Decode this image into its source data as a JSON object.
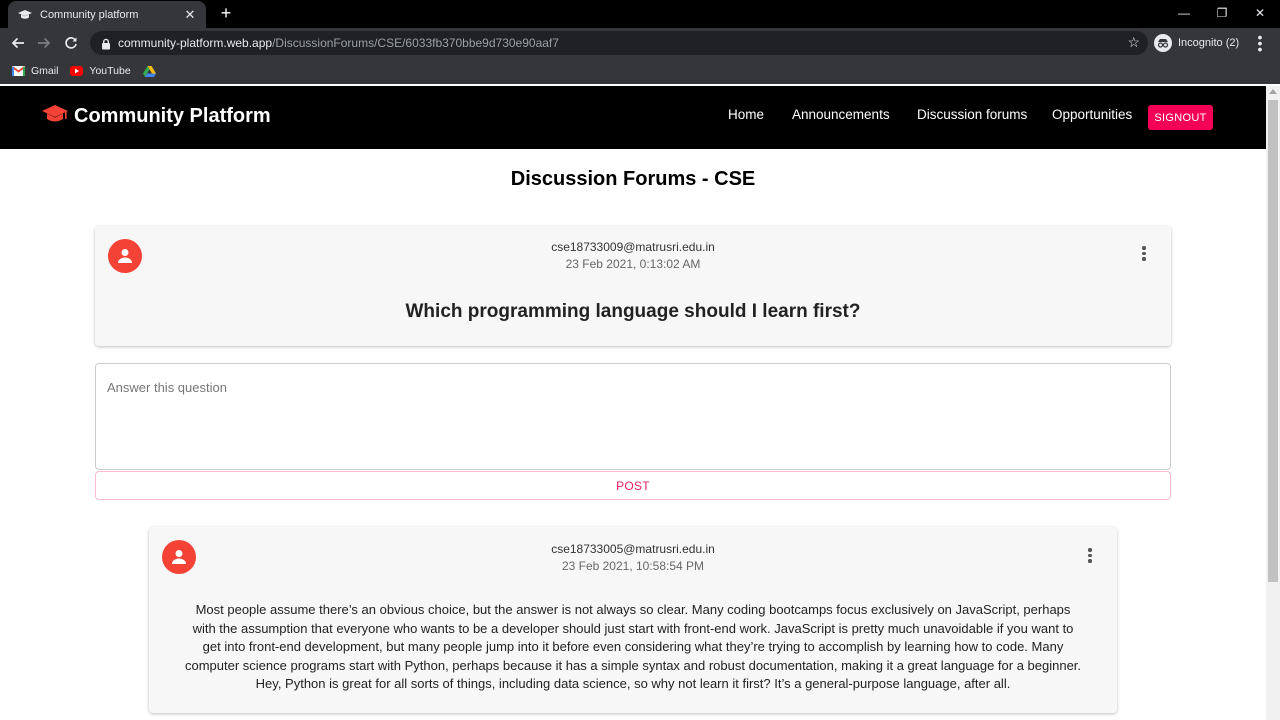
{
  "browser": {
    "tab_title": "Community platform",
    "url_host": "community-platform.web.app",
    "url_path": "/DiscussionForums/CSE/6033fb370bbe9d730e90aaf7",
    "incognito_label": "Incognito (2)",
    "bookmarks": [
      {
        "label": "Gmail",
        "icon": "gmail-icon"
      },
      {
        "label": "YouTube",
        "icon": "youtube-icon"
      },
      {
        "label": "",
        "icon": "google-drive-icon"
      }
    ]
  },
  "app": {
    "brand": "Community Platform",
    "brand_icon": "graduation-cap-icon",
    "nav": [
      "Home",
      "Announcements",
      "Discussion forums",
      "Opportunities"
    ],
    "signout_label": "SIGNOUT",
    "colors": {
      "navbar": "#000000",
      "accent": "#f50057",
      "avatar": "#f44336"
    }
  },
  "page": {
    "title": "Discussion Forums - CSE"
  },
  "question": {
    "author": "cse18733009@matrusri.edu.in",
    "timestamp": "23 Feb 2021, 0:13:02 AM",
    "text": "Which programming language should I learn first?"
  },
  "answer_form": {
    "placeholder": "Answer this question",
    "value": "",
    "post_label": "POST"
  },
  "answers": [
    {
      "author": "cse18733005@matrusri.edu.in",
      "timestamp": "23 Feb 2021, 10:58:54 PM",
      "lines": [
        "Most people assume there’s an obvious choice, but the answer is not always so clear. Many coding bootcamps focus exclusively on JavaScript, perhaps",
        "with the assumption that everyone who wants to be a developer should just start with front-end work. JavaScript is pretty much unavoidable if you want to",
        "get into front-end development, but many people jump into it before even considering what they’re trying to accomplish by learning how to code. Many",
        "computer science programs start with Python, perhaps because it has a simple syntax and robust documentation, making it a great language for a beginner.",
        "Hey, Python is great for all sorts of things, including data science, so why not learn it first? It’s a general-purpose language, after all."
      ]
    }
  ]
}
